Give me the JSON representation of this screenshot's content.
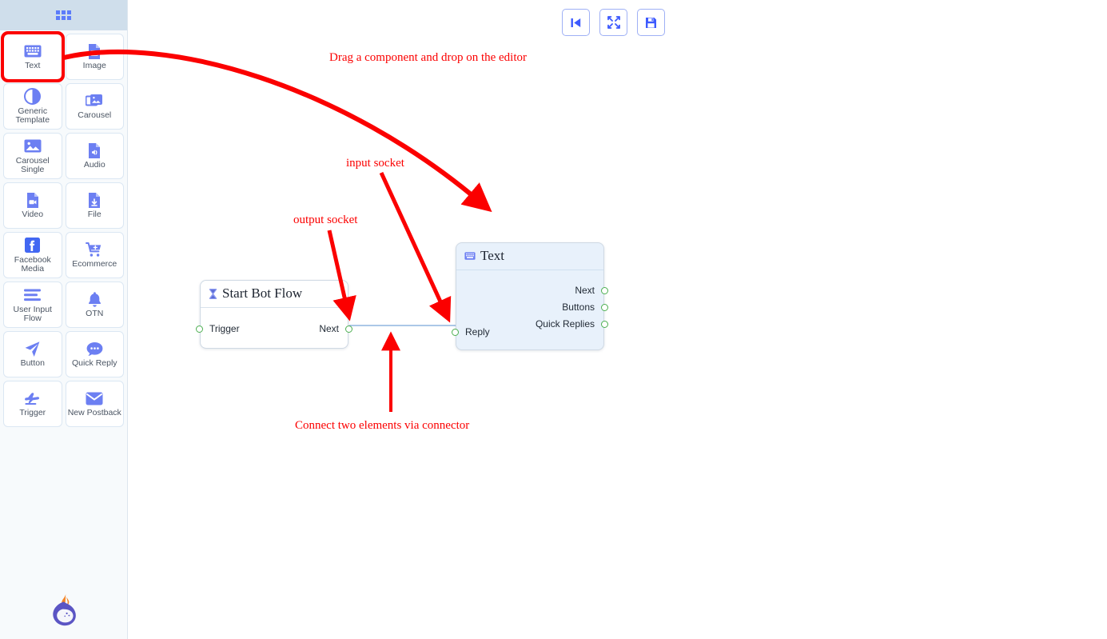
{
  "app": {
    "background": "#ffffff",
    "accent": "#5c7cfa",
    "annotation_color": "#fb0000",
    "socket_color": "#4caf50"
  },
  "sidebar": {
    "header_icon": "grid-menu-icon",
    "logo_icon": "brand-flame-logo",
    "items": [
      {
        "label": "Text",
        "icon": "keyboard-icon",
        "selected": true
      },
      {
        "label": "Image",
        "icon": "image-file-icon",
        "selected": false
      },
      {
        "label": "Generic Template",
        "icon": "contrast-circle-icon",
        "selected": false
      },
      {
        "label": "Carousel",
        "icon": "stacked-images-icon",
        "selected": false
      },
      {
        "label": "Carousel Single",
        "icon": "picture-icon",
        "selected": false
      },
      {
        "label": "Audio",
        "icon": "audio-file-icon",
        "selected": false
      },
      {
        "label": "Video",
        "icon": "video-file-icon",
        "selected": false
      },
      {
        "label": "File",
        "icon": "download-file-icon",
        "selected": false
      },
      {
        "label": "Facebook Media",
        "icon": "facebook-icon",
        "selected": false
      },
      {
        "label": "Ecommerce",
        "icon": "shopping-cart-icon",
        "selected": false
      },
      {
        "label": "User Input Flow",
        "icon": "list-lines-icon",
        "selected": false
      },
      {
        "label": "OTN",
        "icon": "bell-icon",
        "selected": false
      },
      {
        "label": "Button",
        "icon": "paper-plane-icon",
        "selected": false
      },
      {
        "label": "Quick Reply",
        "icon": "chat-bubble-icon",
        "selected": false
      },
      {
        "label": "Trigger",
        "icon": "airplane-icon",
        "selected": false
      },
      {
        "label": "New Postback",
        "icon": "envelope-icon",
        "selected": false
      }
    ]
  },
  "toolbar": {
    "buttons": [
      {
        "name": "skip-to-start-button",
        "icon": "skip-back-icon"
      },
      {
        "name": "fit-to-screen-button",
        "icon": "compress-arrows-icon"
      },
      {
        "name": "save-button",
        "icon": "floppy-disk-save-icon"
      }
    ]
  },
  "canvas": {
    "nodes": [
      {
        "id": "start-bot-flow",
        "title": "Start Bot Flow",
        "icon": "hourglass-icon",
        "inputs": [
          {
            "label": "Trigger"
          }
        ],
        "outputs": [
          {
            "label": "Next"
          }
        ]
      },
      {
        "id": "text",
        "title": "Text",
        "icon": "keyboard-icon",
        "inputs": [
          {
            "label": "Reply"
          }
        ],
        "outputs": [
          {
            "label": "Next"
          },
          {
            "label": "Buttons"
          },
          {
            "label": "Quick Replies"
          }
        ]
      }
    ],
    "connections": [
      {
        "from": "start-bot-flow.Next",
        "to": "text.Reply"
      }
    ]
  },
  "annotations": [
    {
      "id": "drag",
      "text": "Drag a component and drop on the editor"
    },
    {
      "id": "input",
      "text": "input socket"
    },
    {
      "id": "output",
      "text": "output socket"
    },
    {
      "id": "connect",
      "text": "Connect two elements via connector"
    }
  ]
}
